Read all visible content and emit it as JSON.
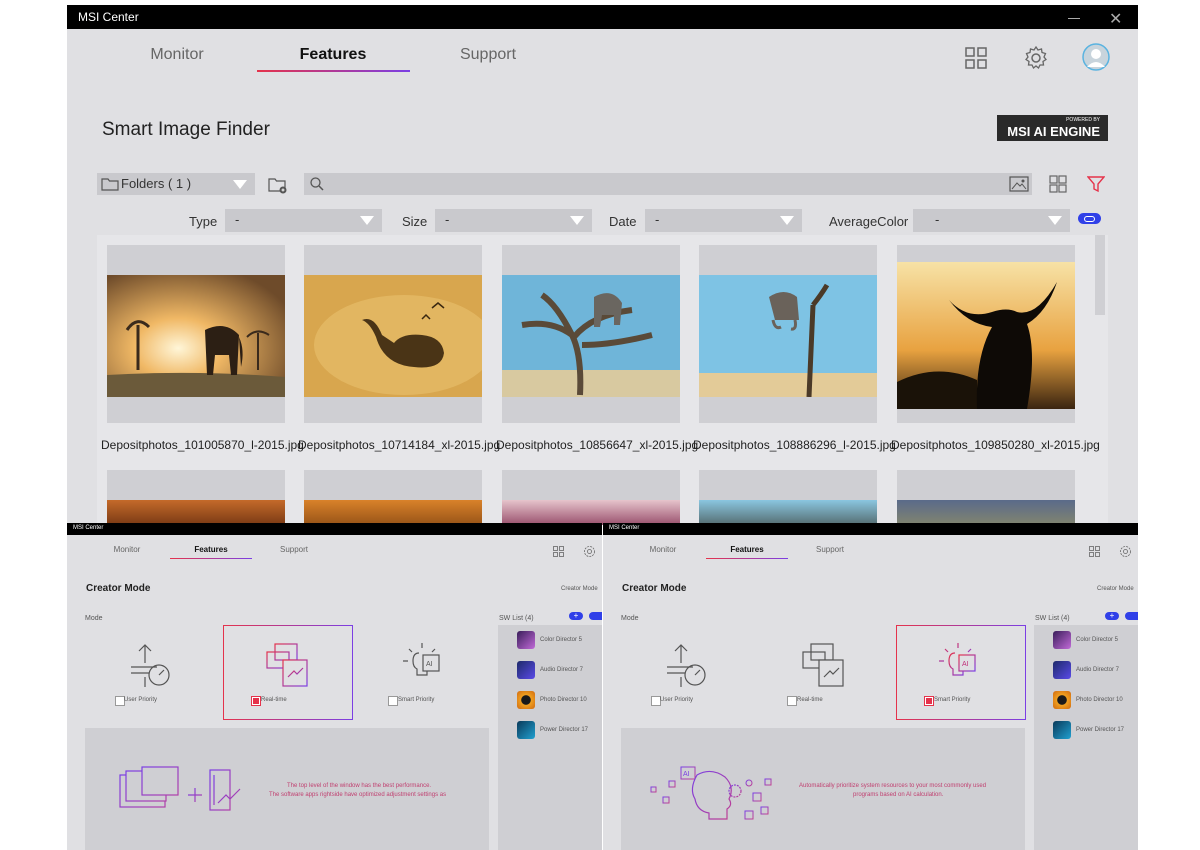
{
  "main": {
    "window_title": "MSI Center",
    "tabs": [
      {
        "label": "Monitor"
      },
      {
        "label": "Features"
      },
      {
        "label": "Support"
      }
    ],
    "active_tab": "Features",
    "page_title": "Smart Image Finder",
    "badge": {
      "top": "POWERED BY",
      "main": "MSI AI ENGINE"
    },
    "folders_label": "Folders ( 1 )",
    "filters": {
      "type_label": "Type",
      "type_value": "-",
      "size_label": "Size",
      "size_value": "-",
      "date_label": "Date",
      "date_value": "-",
      "color_label": "AverageColor",
      "color_value": "-"
    },
    "images": [
      {
        "name": "Depositphotos_101005870_l-2015.jpg"
      },
      {
        "name": "Depositphotos_10714184_xl-2015.jpg"
      },
      {
        "name": "Depositphotos_10856647_xl-2015.jpg"
      },
      {
        "name": "Depositphotos_108886296_l-2015.jpg"
      },
      {
        "name": "Depositphotos_109850280_xl-2015.jpg"
      }
    ]
  },
  "left": {
    "window_title": "MSI Center",
    "tabs": [
      {
        "label": "Monitor"
      },
      {
        "label": "Features"
      },
      {
        "label": "Support"
      }
    ],
    "page_title": "Creator Mode",
    "corner_text": "Creator Mode",
    "mode_label": "Mode",
    "modes": [
      {
        "label": "User Priority"
      },
      {
        "label": "Real-time"
      },
      {
        "label": "Smart Priority"
      }
    ],
    "selected_mode": "Real-time",
    "sw_list_label": "SW List (4)",
    "sw_list": [
      {
        "label": "Color Director 5"
      },
      {
        "label": "Audio Director 7"
      },
      {
        "label": "Photo Director 10"
      },
      {
        "label": "Power Director 17"
      }
    ],
    "description_line1": "The top level of the window has the best performance.",
    "description_line2": "The software apps rightside have optimized adjustment settings as"
  },
  "right": {
    "window_title": "MSI Center",
    "tabs": [
      {
        "label": "Monitor"
      },
      {
        "label": "Features"
      },
      {
        "label": "Support"
      }
    ],
    "page_title": "Creator Mode",
    "corner_text": "Creator Mode",
    "mode_label": "Mode",
    "modes": [
      {
        "label": "User Priority"
      },
      {
        "label": "Real-time"
      },
      {
        "label": "Smart Priority"
      }
    ],
    "selected_mode": "Smart Priority",
    "sw_list_label": "SW List (4)",
    "sw_list": [
      {
        "label": "Color Director 5"
      },
      {
        "label": "Audio Director 7"
      },
      {
        "label": "Photo Director 10"
      },
      {
        "label": "Power Director 17"
      }
    ],
    "description_line1": "Automatically prioritize system resources to your most commonly used",
    "description_line2": "programs based on AI calculation."
  },
  "colors": {
    "accent_red": "#e5334b",
    "accent_purple": "#7b3fe4",
    "panel": "#e0e0e3",
    "icon_purple": "#8b3fb8"
  }
}
